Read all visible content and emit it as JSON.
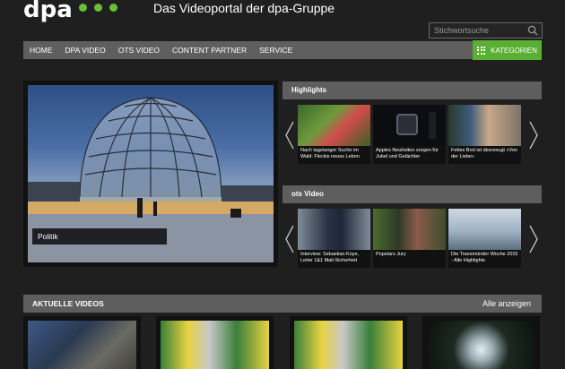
{
  "header": {
    "logo_text": "dpa",
    "tagline": "Das Videoportal der dpa-Gruppe",
    "search_placeholder": "Stichwortsuche",
    "brand_color": "#6abf3a"
  },
  "nav": {
    "items": [
      "Home",
      "dpa Video",
      "OTS Video",
      "Content Partner",
      "Service"
    ],
    "categories_label": "Kategorien",
    "categories_color": "#5ab033"
  },
  "hero": {
    "label": "Politik"
  },
  "highlights": {
    "title": "Highlights",
    "items": [
      {
        "caption": "Nach tagelanger Suche im Wald: Fleckis neues Leben"
      },
      {
        "caption": "Apples Neuheiten sorgen für Jubel und Gelächter"
      },
      {
        "caption": "Fettes Brot ist überzeugt »Von der Liebe«"
      }
    ]
  },
  "ots": {
    "title": "ots Video",
    "items": [
      {
        "caption": "Interview: Sebastian Koye, Leiter 1&1 Mail-Sicherheit"
      },
      {
        "caption": "Popstars Jury"
      },
      {
        "caption": "Die Travemünder Woche 2015 - Alle Highlights"
      }
    ]
  },
  "aktuelle": {
    "title": "Aktuelle Videos",
    "show_all": "Alle anzeigen"
  },
  "icons": {
    "search": "search-icon",
    "grid": "grid-icon",
    "arrow_left": "chevron-left-icon",
    "arrow_right": "chevron-right-icon"
  }
}
